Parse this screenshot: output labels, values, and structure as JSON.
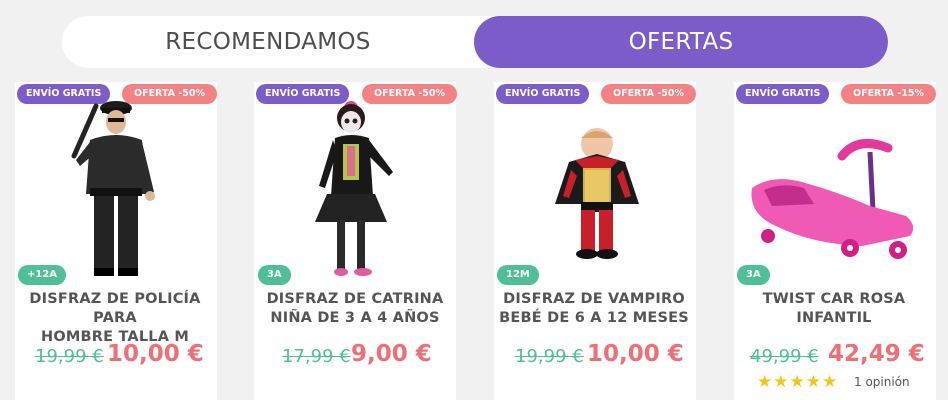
{
  "tabs": [
    {
      "label": "RECOMENDAMOS",
      "active": false
    },
    {
      "label": "OFERTAS",
      "active": true
    }
  ],
  "colors": {
    "accent": "#7b5cc8",
    "offer_badge": "#f48184",
    "age_badge": "#4fbf98",
    "old_price": "#4fbf98",
    "new_price": "#ee6f76",
    "star": "#f5c518"
  },
  "products": [
    {
      "shipping_badge": "ENVÍO GRATIS",
      "offer_badge": "OFERTA -50%",
      "age": "+12A",
      "title_line1": "DISFRAZ DE POLICÍA PARA",
      "title_line2": "HOMBRE TALLA M",
      "old_price": "19,99 €",
      "new_price": "10,00 €",
      "image": "police-costume"
    },
    {
      "shipping_badge": "ENVÍO GRATIS",
      "offer_badge": "OFERTA -50%",
      "age": "3A",
      "title_line1": "DISFRAZ DE CATRINA",
      "title_line2": "NIÑA DE 3 A 4 AÑOS",
      "old_price": "17,99 €",
      "new_price": "9,00 €",
      "image": "catrina-costume"
    },
    {
      "shipping_badge": "ENVÍO GRATIS",
      "offer_badge": "OFERTA -50%",
      "age": "12M",
      "title_line1": "DISFRAZ DE VAMPIRO",
      "title_line2": "BEBÉ DE 6 A 12 MESES",
      "old_price": "19,99 €",
      "new_price": "10,00 €",
      "image": "vampire-baby-costume"
    },
    {
      "shipping_badge": "ENVÍO GRATIS",
      "offer_badge": "OFERTA -15%",
      "age": "3A",
      "title_line1": "TWIST CAR ROSA",
      "title_line2": "INFANTIL",
      "old_price": "49,99 €",
      "new_price": "42,49 €",
      "image": "pink-twist-car",
      "rating": 5,
      "reviews": "1 opinión"
    }
  ]
}
